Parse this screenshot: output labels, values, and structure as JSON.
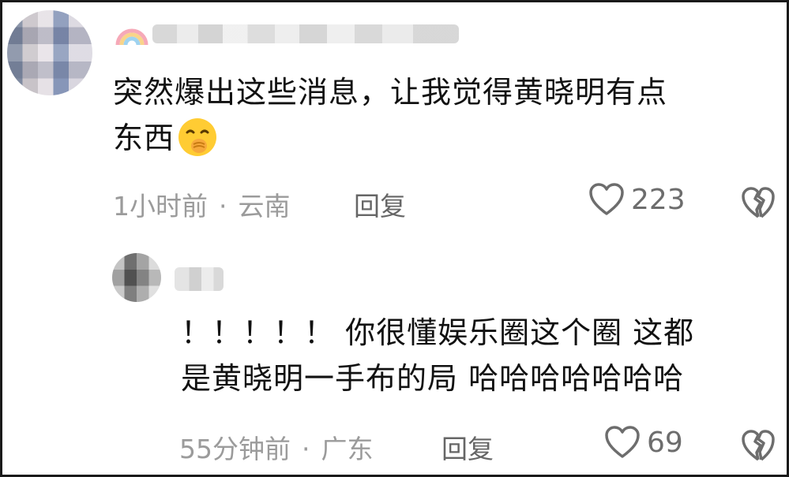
{
  "comment": {
    "text_line1": "突然爆出这些消息，让我觉得黄晓明有点",
    "text_line2": "东西",
    "emoji": "shushing-face-emoji",
    "time": "1小时前",
    "separator": "·",
    "location": "云南",
    "reply_label": "回复",
    "like_count": "223",
    "rainbow_icon": "rainbow-icon"
  },
  "reply": {
    "text_line1": "！！！！！ 你很懂娱乐圈这个圈 这都",
    "text_line2": "是黄晓明一手布的局 哈哈哈哈哈哈哈",
    "time": "55分钟前",
    "separator": "·",
    "location": "广东",
    "reply_label": "回复",
    "like_count": "69"
  },
  "colors": {
    "text": "#111111",
    "meta": "#9b9b9b",
    "icon": "#6d6d6d",
    "border": "#1a1a1a"
  }
}
